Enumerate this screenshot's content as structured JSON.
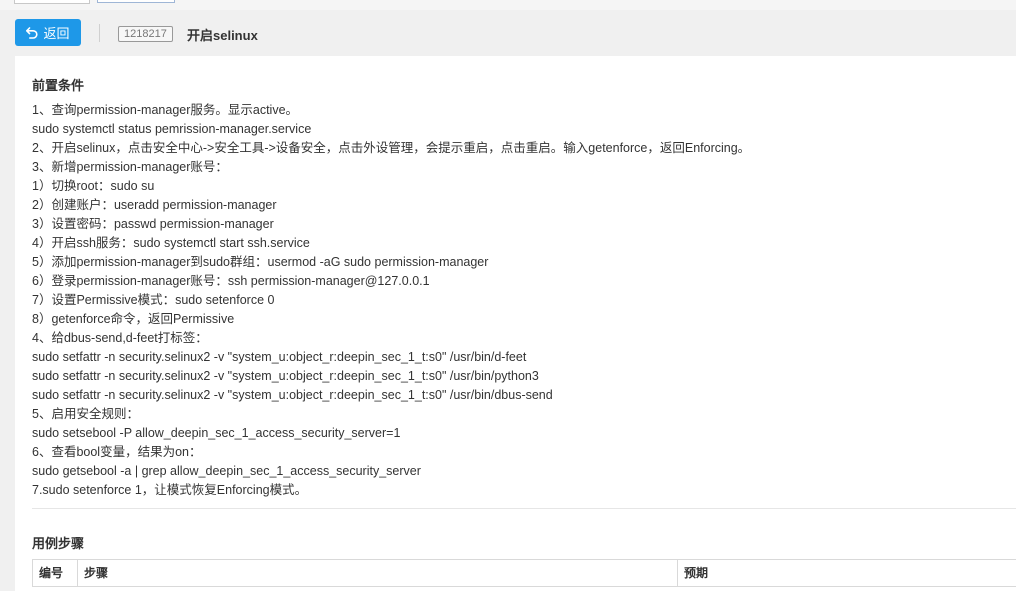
{
  "header": {
    "back_label": "返回",
    "case_id": "1218217",
    "case_title": "开启selinux"
  },
  "preconditions": {
    "title": "前置条件",
    "lines": [
      "1、查询permission-manager服务。显示active。",
      "sudo systemctl status pemrission-manager.service",
      "2、开启selinux，点击安全中心->安全工具->设备安全，点击外设管理，会提示重启，点击重启。输入getenforce，返回Enforcing。",
      "3、新增permission-manager账号：",
      "1）切换root：sudo su",
      "2）创建账户：useradd permission-manager",
      "3）设置密码：passwd permission-manager",
      "4）开启ssh服务：sudo systemctl start ssh.service",
      "5）添加permission-manager到sudo群组：usermod -aG sudo permission-manager",
      "6）登录permission-manager账号：ssh permission-manager@127.0.0.1",
      "7）设置Permissive模式：sudo setenforce 0",
      "8）getenforce命令，返回Permissive",
      "4、给dbus-send,d-feet打标签：",
      "sudo setfattr -n security.selinux2 -v \"system_u:object_r:deepin_sec_1_t:s0\" /usr/bin/d-feet",
      "sudo setfattr -n security.selinux2 -v \"system_u:object_r:deepin_sec_1_t:s0\" /usr/bin/python3",
      "sudo setfattr -n security.selinux2 -v \"system_u:object_r:deepin_sec_1_t:s0\" /usr/bin/dbus-send",
      "5、启用安全规则：",
      "sudo setsebool -P allow_deepin_sec_1_access_security_server=1",
      "6、查看bool变量，结果为on：",
      "sudo getsebool -a | grep allow_deepin_sec_1_access_security_server",
      "7.sudo setenforce 1，让模式恢复Enforcing模式。"
    ]
  },
  "steps": {
    "title": "用例步骤",
    "columns": [
      "编号",
      "步骤",
      "预期"
    ]
  },
  "colors": {
    "accent": "#1e98e8",
    "page_bg": "#f0f0f0",
    "panel_bg": "#ffffff"
  },
  "icons": {
    "back": "undo-arrow-icon"
  }
}
